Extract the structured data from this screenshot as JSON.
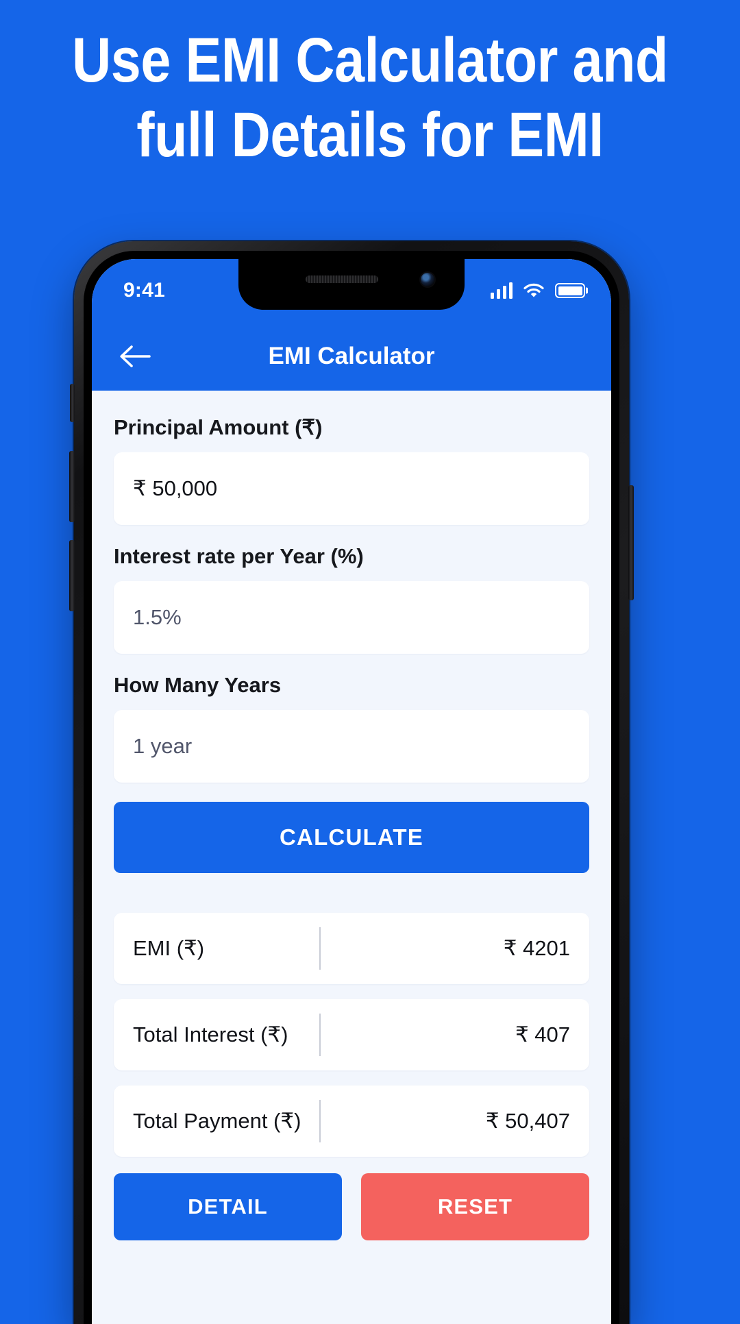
{
  "promo": {
    "headline": "Use EMI Calculator and\nfull Details for EMI",
    "background_color": "#1565E8",
    "headline_color": "#FFFFFF"
  },
  "phone": {
    "status_bar": {
      "time": "9:41",
      "signal_icon": "signal-bars-icon",
      "wifi_icon": "wifi-icon",
      "battery_icon": "battery-full-icon"
    },
    "app_bar": {
      "back_icon": "back-arrow-icon",
      "title": "EMI Calculator"
    },
    "form": {
      "fields": [
        {
          "label": "Principal Amount (₹)",
          "value": "₹ 50,000",
          "state": "filled"
        },
        {
          "label": "Interest rate per Year (%)",
          "value": "1.5%",
          "state": "placeholder"
        },
        {
          "label": "How Many Years",
          "value": "1 year",
          "state": "placeholder"
        }
      ],
      "calculate_label": "CALCULATE"
    },
    "results": [
      {
        "label": "EMI (₹)",
        "value": "₹ 4201"
      },
      {
        "label": "Total Interest (₹)",
        "value": "₹ 407"
      },
      {
        "label": "Total Payment (₹)",
        "value": "₹ 50,407"
      }
    ],
    "actions": {
      "detail_label": "DETAIL",
      "reset_label": "RESET"
    },
    "colors": {
      "primary": "#1565E8",
      "reset": "#F4625E",
      "page_bg": "#F2F6FD",
      "card": "#FFFFFF"
    }
  }
}
